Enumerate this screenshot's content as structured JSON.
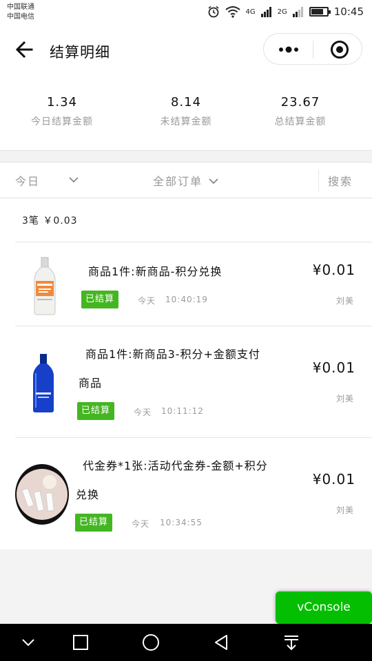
{
  "status_bar": {
    "carrier_1": "中国联通",
    "carrier_2": "中国电信",
    "network_1": "4G",
    "network_2": "2G",
    "time": "10:45",
    "battery_level": 0.7
  },
  "header": {
    "title": "结算明细"
  },
  "summary": [
    {
      "value": "1.34",
      "label": "今日结算金额"
    },
    {
      "value": "8.14",
      "label": "未结算金额"
    },
    {
      "value": "23.67",
      "label": "总结算金额"
    }
  ],
  "filters": {
    "date": "今日",
    "orders": "全部订单",
    "search": "搜索"
  },
  "count_line": "3笔 ￥0.03",
  "orders": [
    {
      "title_line1": "商品1件:新商品-积分兑换",
      "title_line2": "",
      "status": "已结算",
      "day": "今天",
      "time": "10:40:19",
      "amount": "¥0.01",
      "person": "刘美",
      "thumb_icon": "orange-vodka-bottle-image"
    },
    {
      "title_line1": "商品1件:新商品3-积分+金额支付",
      "title_line2": "商品",
      "status": "已结算",
      "day": "今天",
      "time": "10:11:12",
      "amount": "¥0.01",
      "person": "刘美",
      "thumb_icon": "blue-vodka-bottle-image"
    },
    {
      "title_line1": "代金券*1张:活动代金券-金额+积分",
      "title_line2": "兑换",
      "status": "已结算",
      "day": "今天",
      "time": "10:34:55",
      "amount": "¥0.01",
      "person": "刘美",
      "thumb_icon": "voucher-photo-image"
    }
  ],
  "vconsole": "vConsole",
  "colors": {
    "badge_green": "#44b621",
    "vconsole_green": "#04be02",
    "muted_text": "#9b9b9b"
  }
}
